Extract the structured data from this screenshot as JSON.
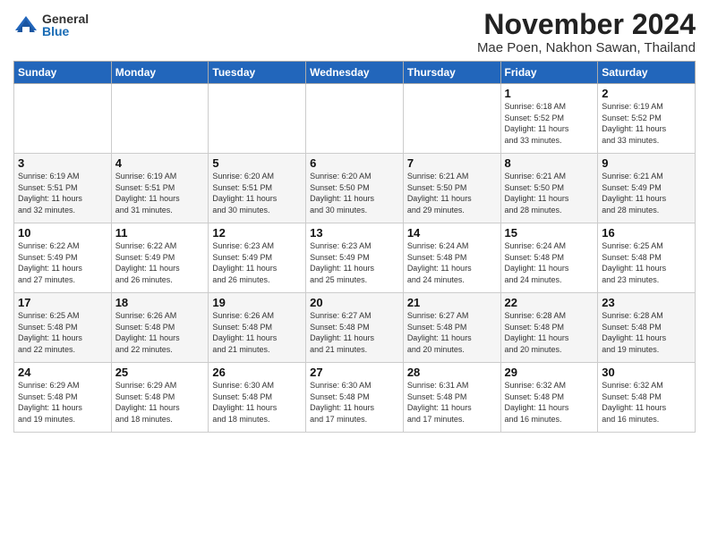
{
  "logo": {
    "general": "General",
    "blue": "Blue"
  },
  "title": "November 2024",
  "subtitle": "Mae Poen, Nakhon Sawan, Thailand",
  "days_of_week": [
    "Sunday",
    "Monday",
    "Tuesday",
    "Wednesday",
    "Thursday",
    "Friday",
    "Saturday"
  ],
  "weeks": [
    [
      {
        "day": "",
        "info": ""
      },
      {
        "day": "",
        "info": ""
      },
      {
        "day": "",
        "info": ""
      },
      {
        "day": "",
        "info": ""
      },
      {
        "day": "",
        "info": ""
      },
      {
        "day": "1",
        "info": "Sunrise: 6:18 AM\nSunset: 5:52 PM\nDaylight: 11 hours\nand 33 minutes."
      },
      {
        "day": "2",
        "info": "Sunrise: 6:19 AM\nSunset: 5:52 PM\nDaylight: 11 hours\nand 33 minutes."
      }
    ],
    [
      {
        "day": "3",
        "info": "Sunrise: 6:19 AM\nSunset: 5:51 PM\nDaylight: 11 hours\nand 32 minutes."
      },
      {
        "day": "4",
        "info": "Sunrise: 6:19 AM\nSunset: 5:51 PM\nDaylight: 11 hours\nand 31 minutes."
      },
      {
        "day": "5",
        "info": "Sunrise: 6:20 AM\nSunset: 5:51 PM\nDaylight: 11 hours\nand 30 minutes."
      },
      {
        "day": "6",
        "info": "Sunrise: 6:20 AM\nSunset: 5:50 PM\nDaylight: 11 hours\nand 30 minutes."
      },
      {
        "day": "7",
        "info": "Sunrise: 6:21 AM\nSunset: 5:50 PM\nDaylight: 11 hours\nand 29 minutes."
      },
      {
        "day": "8",
        "info": "Sunrise: 6:21 AM\nSunset: 5:50 PM\nDaylight: 11 hours\nand 28 minutes."
      },
      {
        "day": "9",
        "info": "Sunrise: 6:21 AM\nSunset: 5:49 PM\nDaylight: 11 hours\nand 28 minutes."
      }
    ],
    [
      {
        "day": "10",
        "info": "Sunrise: 6:22 AM\nSunset: 5:49 PM\nDaylight: 11 hours\nand 27 minutes."
      },
      {
        "day": "11",
        "info": "Sunrise: 6:22 AM\nSunset: 5:49 PM\nDaylight: 11 hours\nand 26 minutes."
      },
      {
        "day": "12",
        "info": "Sunrise: 6:23 AM\nSunset: 5:49 PM\nDaylight: 11 hours\nand 26 minutes."
      },
      {
        "day": "13",
        "info": "Sunrise: 6:23 AM\nSunset: 5:49 PM\nDaylight: 11 hours\nand 25 minutes."
      },
      {
        "day": "14",
        "info": "Sunrise: 6:24 AM\nSunset: 5:48 PM\nDaylight: 11 hours\nand 24 minutes."
      },
      {
        "day": "15",
        "info": "Sunrise: 6:24 AM\nSunset: 5:48 PM\nDaylight: 11 hours\nand 24 minutes."
      },
      {
        "day": "16",
        "info": "Sunrise: 6:25 AM\nSunset: 5:48 PM\nDaylight: 11 hours\nand 23 minutes."
      }
    ],
    [
      {
        "day": "17",
        "info": "Sunrise: 6:25 AM\nSunset: 5:48 PM\nDaylight: 11 hours\nand 22 minutes."
      },
      {
        "day": "18",
        "info": "Sunrise: 6:26 AM\nSunset: 5:48 PM\nDaylight: 11 hours\nand 22 minutes."
      },
      {
        "day": "19",
        "info": "Sunrise: 6:26 AM\nSunset: 5:48 PM\nDaylight: 11 hours\nand 21 minutes."
      },
      {
        "day": "20",
        "info": "Sunrise: 6:27 AM\nSunset: 5:48 PM\nDaylight: 11 hours\nand 21 minutes."
      },
      {
        "day": "21",
        "info": "Sunrise: 6:27 AM\nSunset: 5:48 PM\nDaylight: 11 hours\nand 20 minutes."
      },
      {
        "day": "22",
        "info": "Sunrise: 6:28 AM\nSunset: 5:48 PM\nDaylight: 11 hours\nand 20 minutes."
      },
      {
        "day": "23",
        "info": "Sunrise: 6:28 AM\nSunset: 5:48 PM\nDaylight: 11 hours\nand 19 minutes."
      }
    ],
    [
      {
        "day": "24",
        "info": "Sunrise: 6:29 AM\nSunset: 5:48 PM\nDaylight: 11 hours\nand 19 minutes."
      },
      {
        "day": "25",
        "info": "Sunrise: 6:29 AM\nSunset: 5:48 PM\nDaylight: 11 hours\nand 18 minutes."
      },
      {
        "day": "26",
        "info": "Sunrise: 6:30 AM\nSunset: 5:48 PM\nDaylight: 11 hours\nand 18 minutes."
      },
      {
        "day": "27",
        "info": "Sunrise: 6:30 AM\nSunset: 5:48 PM\nDaylight: 11 hours\nand 17 minutes."
      },
      {
        "day": "28",
        "info": "Sunrise: 6:31 AM\nSunset: 5:48 PM\nDaylight: 11 hours\nand 17 minutes."
      },
      {
        "day": "29",
        "info": "Sunrise: 6:32 AM\nSunset: 5:48 PM\nDaylight: 11 hours\nand 16 minutes."
      },
      {
        "day": "30",
        "info": "Sunrise: 6:32 AM\nSunset: 5:48 PM\nDaylight: 11 hours\nand 16 minutes."
      }
    ]
  ]
}
